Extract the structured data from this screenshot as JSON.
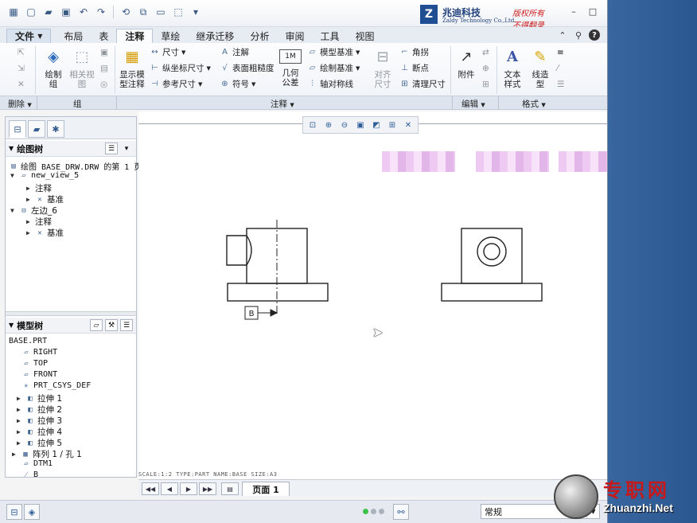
{
  "quick_access": [
    "new-icon",
    "open-icon",
    "save-icon",
    "undo-icon",
    "redo-icon",
    "regen-icon",
    "windows-icon",
    "select-box-icon",
    "more-icon"
  ],
  "logo": {
    "mark": "Z",
    "name": "兆迪科技",
    "en": "Zaldy Technology Co.,Ltd.",
    "slogan1": "版权所有",
    "slogan2": "不得翻录"
  },
  "tabs": [
    {
      "label": "文件"
    },
    {
      "label": "布局"
    },
    {
      "label": "表"
    },
    {
      "label": "注释"
    },
    {
      "label": "草绘"
    },
    {
      "label": "继承迁移"
    },
    {
      "label": "分析"
    },
    {
      "label": "审阅"
    },
    {
      "label": "工具"
    },
    {
      "label": "视图"
    }
  ],
  "active_tab": "注释",
  "ribbon": {
    "delete_group": "删除",
    "group_group": "组",
    "draw_group_btn": "绘制\n组",
    "related_view_btn": "相关视\n图",
    "show_model_btn": "显示模\n型注释",
    "dimension": "尺寸",
    "ordinate_dim": "纵坐标尺寸",
    "ref_dim": "参考尺寸",
    "note": "注解",
    "surface_finish": "表面粗糙度",
    "symbol": "符号",
    "gtol_value": "1M",
    "gtol_btn": "几何\n公差",
    "model_datum": "模型基准",
    "draw_datum": "绘制基准",
    "axis_symmetry": "轴对称线",
    "align_dim_btn": "对齐\n尺寸",
    "corner": "角拐",
    "breakpoint": "断点",
    "cleanup_dim": "清理尺寸",
    "annotate_group": "注释",
    "attach_btn": "附件",
    "edit_group": "编辑",
    "text_style_btn": "文本\n样式",
    "line_style_btn": "线造\n型",
    "format_group": "格式"
  },
  "drawing_tree": {
    "title": "绘图树",
    "items": [
      {
        "label": "绘图 BASE_DRW.DRW 的第 1 页"
      },
      {
        "label": "new_view_5"
      },
      {
        "label": "注释"
      },
      {
        "label": "基准"
      },
      {
        "label": "左边_6"
      },
      {
        "label": "注释"
      },
      {
        "label": "基准"
      }
    ]
  },
  "model_tree": {
    "title": "模型树",
    "root": "BASE.PRT",
    "items": [
      {
        "label": "RIGHT",
        "icon": "datum-plane-icon"
      },
      {
        "label": "TOP",
        "icon": "datum-plane-icon"
      },
      {
        "label": "FRONT",
        "icon": "datum-plane-icon"
      },
      {
        "label": "PRT_CSYS_DEF",
        "icon": "csys-icon"
      },
      {
        "label": "拉伸 1",
        "icon": "extrude-icon"
      },
      {
        "label": "拉伸 2",
        "icon": "extrude-icon"
      },
      {
        "label": "拉伸 3",
        "icon": "extrude-icon"
      },
      {
        "label": "拉伸 4",
        "icon": "extrude-icon"
      },
      {
        "label": "拉伸 5",
        "icon": "extrude-icon"
      },
      {
        "label": "阵列 1 / 孔 1",
        "icon": "pattern-icon"
      },
      {
        "label": "DTM1",
        "icon": "datum-plane-icon"
      },
      {
        "label": "B",
        "icon": "datum-axis-icon"
      }
    ]
  },
  "drawing": {
    "datum_label": "B",
    "status_line": "SCALE:1:2   TYPE:PART   NAME:BASE   SIZE:A3"
  },
  "page_bar": {
    "page_label": "页面 1"
  },
  "status_bar": {
    "filter_value": "常规"
  },
  "watermark": {
    "cn": "专职网",
    "en": "Zhuanzhi.Net"
  }
}
